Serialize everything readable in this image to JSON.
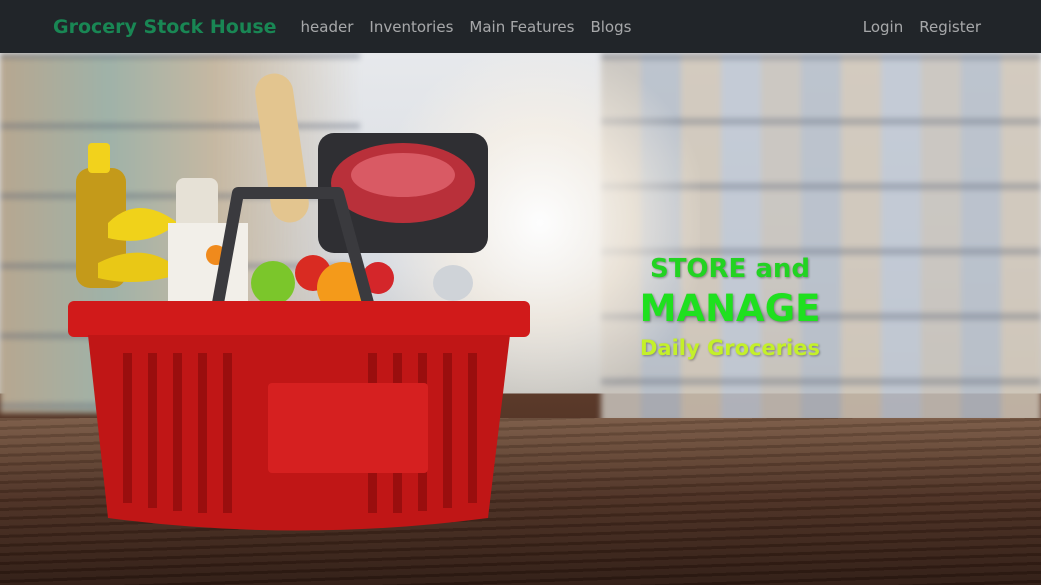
{
  "navbar": {
    "brand": "Grocery Stock House",
    "links": [
      "header",
      "Inventories",
      "Main Features",
      "Blogs"
    ],
    "auth": {
      "login": "Login",
      "register": "Register"
    }
  },
  "hero": {
    "line1": "STORE and",
    "line2": "MANAGE",
    "line3": "Daily Groceries",
    "image": "grocery-basket-supermarket-photo"
  },
  "colors": {
    "navbar_bg": "#212529",
    "brand": "#198754",
    "tag_green": "#22d322",
    "tag_lime": "#c4f02a"
  }
}
